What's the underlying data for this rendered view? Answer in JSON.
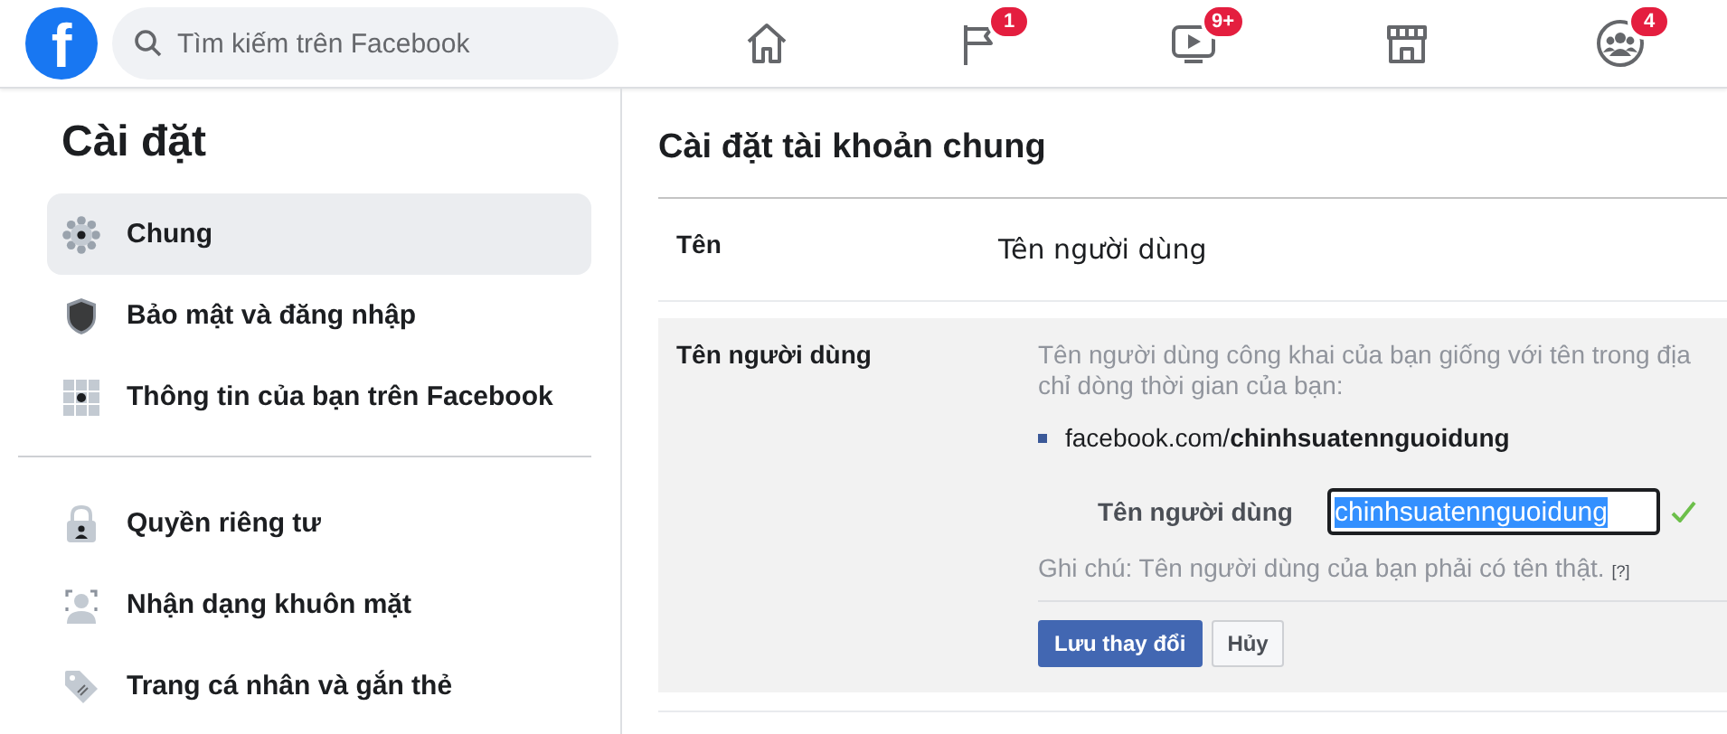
{
  "header": {
    "logo": "f",
    "search": {
      "placeholder": "Tìm kiếm trên Facebook"
    },
    "nav": [
      {
        "kind": "home"
      },
      {
        "kind": "flag",
        "badge": "1"
      },
      {
        "kind": "video",
        "badge": "9+"
      },
      {
        "kind": "store"
      },
      {
        "kind": "groups",
        "badge": "4"
      }
    ]
  },
  "sidebar": {
    "title": "Cài đặt",
    "groups": [
      [
        {
          "kind": "gear",
          "label": "Chung",
          "selected": true
        },
        {
          "kind": "shield",
          "label": "Bảo mật và đăng nhập",
          "selected": false
        },
        {
          "kind": "grid",
          "label": "Thông tin của bạn trên Facebook",
          "selected": false
        }
      ],
      [
        {
          "kind": "lock",
          "label": "Quyền riêng tư",
          "selected": false
        },
        {
          "kind": "face",
          "label": "Nhận dạng khuôn mặt",
          "selected": false
        },
        {
          "kind": "tag",
          "label": "Trang cá nhân và gắn thẻ",
          "selected": false
        }
      ]
    ]
  },
  "main": {
    "title": "Cài đặt tài khoản chung",
    "name_row": {
      "label": "Tên",
      "value": "Tên người dùng"
    },
    "username_row": {
      "label": "Tên người dùng",
      "description_lines": [
        "Tên người dùng công khai của bạn giống với tên trong địa",
        "chỉ dòng thời gian của bạn:"
      ],
      "url": "facebook.com/**chinhsuatennguoidung**",
      "field_label": "Tên người dùng",
      "field_value": "chinhsuatennguoidung",
      "text_selected": true,
      "valid": true,
      "note": "Ghi chú: Tên người dùng của bạn phải có tên thật.",
      "help": "[?]",
      "buttons": [
        {
          "kind": "primary",
          "label": "Lưu thay đổi"
        },
        {
          "kind": "secondary",
          "label": "Hủy"
        }
      ]
    }
  }
}
